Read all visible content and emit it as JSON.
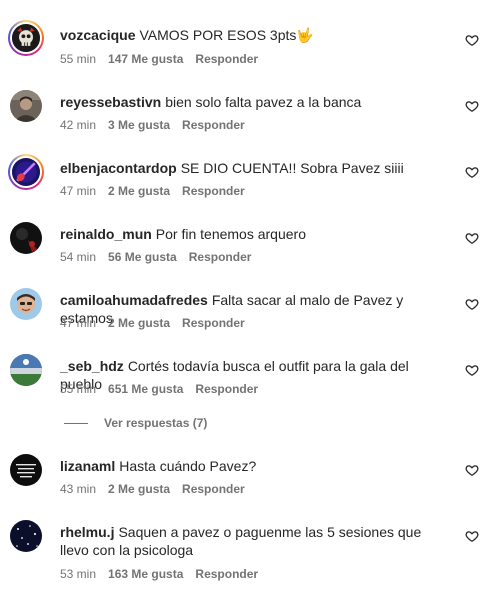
{
  "comments": [
    {
      "username": "vozcacique",
      "text": "VAMOS POR ESOS 3pts🤟",
      "time": "55 min",
      "likes": "147 Me gusta",
      "reply": "Responder",
      "avatar_icon": "skull-avatar-icon"
    },
    {
      "username": "reyessebastivn",
      "text": "bien solo falta pavez a la banca",
      "time": "42 min",
      "likes": "3 Me gusta",
      "reply": "Responder",
      "avatar_icon": "person-avatar-icon"
    },
    {
      "username": "elbenjacontardop",
      "text": "SE DIO CUENTA!! Sobra Pavez siiii",
      "time": "47 min",
      "likes": "2 Me gusta",
      "reply": "Responder",
      "avatar_icon": "guitar-avatar-icon"
    },
    {
      "username": "reinaldo_mun",
      "text": "Por fin tenemos arquero",
      "time": "54 min",
      "likes": "56 Me gusta",
      "reply": "Responder",
      "avatar_icon": "dark-avatar-icon"
    },
    {
      "username": "camiloahumadafredes",
      "text": "Falta sacar al malo de Pavez y estamos",
      "time": "47 min",
      "likes": "2 Me gusta",
      "reply": "Responder",
      "avatar_icon": "face-avatar-icon"
    },
    {
      "username": "_seb_hdz",
      "text": "Cortés todavía busca el outfit para la gala del pueblo",
      "time": "55 min",
      "likes": "651 Me gusta",
      "reply": "Responder",
      "avatar_icon": "stadium-avatar-icon"
    },
    {
      "username": "lizanaml",
      "text": "Hasta cuándo Pavez?",
      "time": "43 min",
      "likes": "2 Me gusta",
      "reply": "Responder",
      "avatar_icon": "text-avatar-icon"
    },
    {
      "username": "rhelmu.j",
      "text": "Saquen a pavez o paguenme las 5 sesiones que llevo con la psicologa",
      "time": "53 min",
      "likes": "163 Me gusta",
      "reply": "Responder",
      "avatar_icon": "stars-avatar-icon"
    }
  ],
  "view_replies": "Ver respuestas (7)",
  "colors": {
    "text": "#262626",
    "secondary": "#737373",
    "background": "#ffffff"
  }
}
